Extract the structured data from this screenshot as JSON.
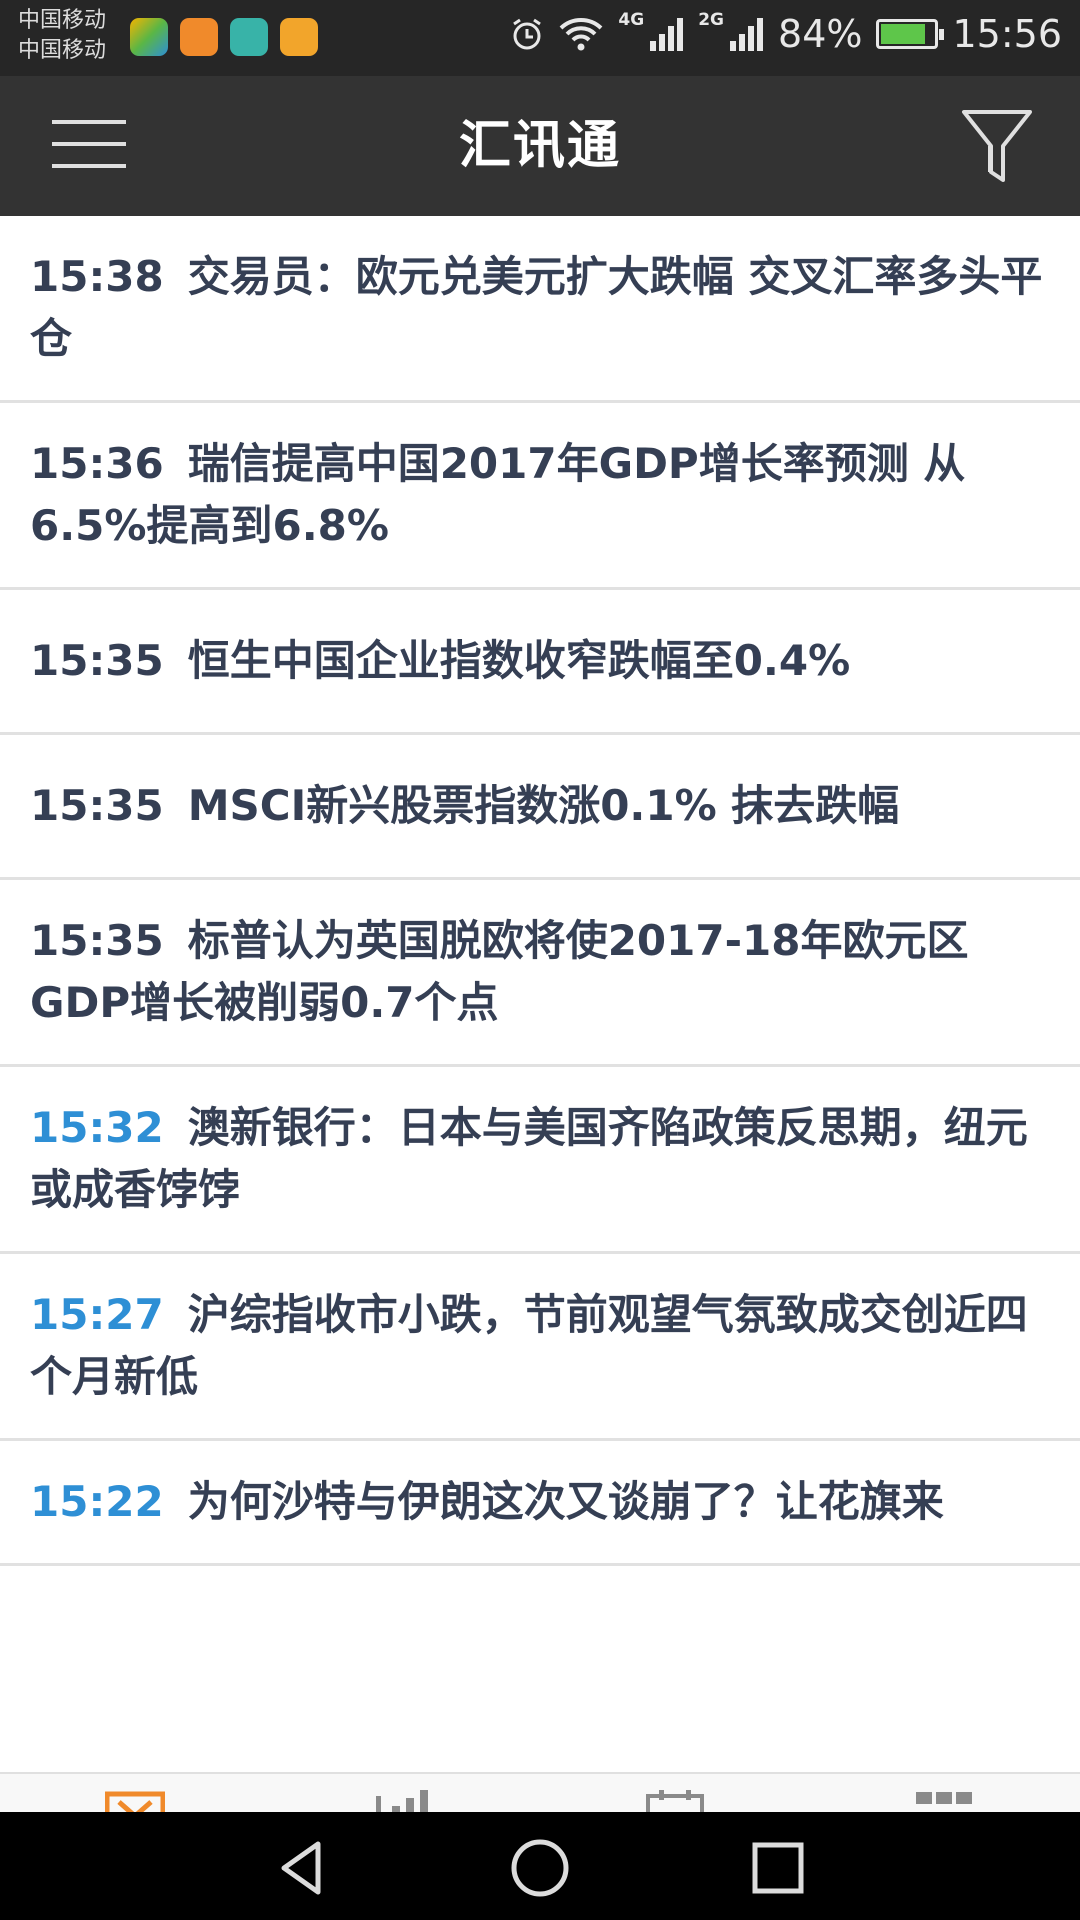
{
  "status_bar": {
    "carrier_1": "中国移动",
    "carrier_2": "中国移动",
    "network_1": "4G",
    "network_2": "2G",
    "battery": "84%",
    "battery_level": 0.84,
    "time": "15:56",
    "icons": [
      "app-icon-1",
      "app-icon-2",
      "app-icon-3",
      "weibo-icon",
      "alarm-icon",
      "wifi-icon",
      "signal-icon",
      "battery-icon"
    ]
  },
  "app_bar": {
    "title": "汇讯通",
    "menu_icon": "hamburger-menu-icon",
    "filter_icon": "filter-icon"
  },
  "colors": {
    "app_bar_bg": "#333333",
    "status_bar_bg": "#262626",
    "headline_text": "#353f54",
    "recent_time": "#2e8fd5",
    "tab_accent": "#f08a2b"
  },
  "news": [
    {
      "time": "15:38",
      "title": "交易员：欧元兑美元扩大跌幅 交叉汇率多头平仓"
    },
    {
      "time": "15:36",
      "title": "瑞信提高中国2017年GDP增长率预测 从6.5%提高到6.8%"
    },
    {
      "time": "15:35",
      "title": "恒生中国企业指数收窄跌幅至0.4%"
    },
    {
      "time": "15:35",
      "title": "MSCI新兴股票指数涨0.1% 抹去跌幅"
    },
    {
      "time": "15:35",
      "title": "标普认为英国脱欧将使2017-18年欧元区GDP增长被削弱0.7个点"
    },
    {
      "time": "15:32",
      "title": "澳新银行：日本与美国齐陷政策反思期，纽元或成香饽饽"
    },
    {
      "time": "15:27",
      "title": "沪综指收市小跌，节前观望气氛致成交创近四个月新低"
    },
    {
      "time": "15:22",
      "title": "为何沙特与伊朗这次又谈崩了？让花旗来"
    }
  ],
  "bottom_tabs": [
    "news-tab-icon",
    "chart-tab-icon",
    "calendar-tab-icon",
    "more-tab-icon"
  ],
  "nav_bar": [
    "back-icon",
    "home-icon",
    "recents-icon"
  ]
}
